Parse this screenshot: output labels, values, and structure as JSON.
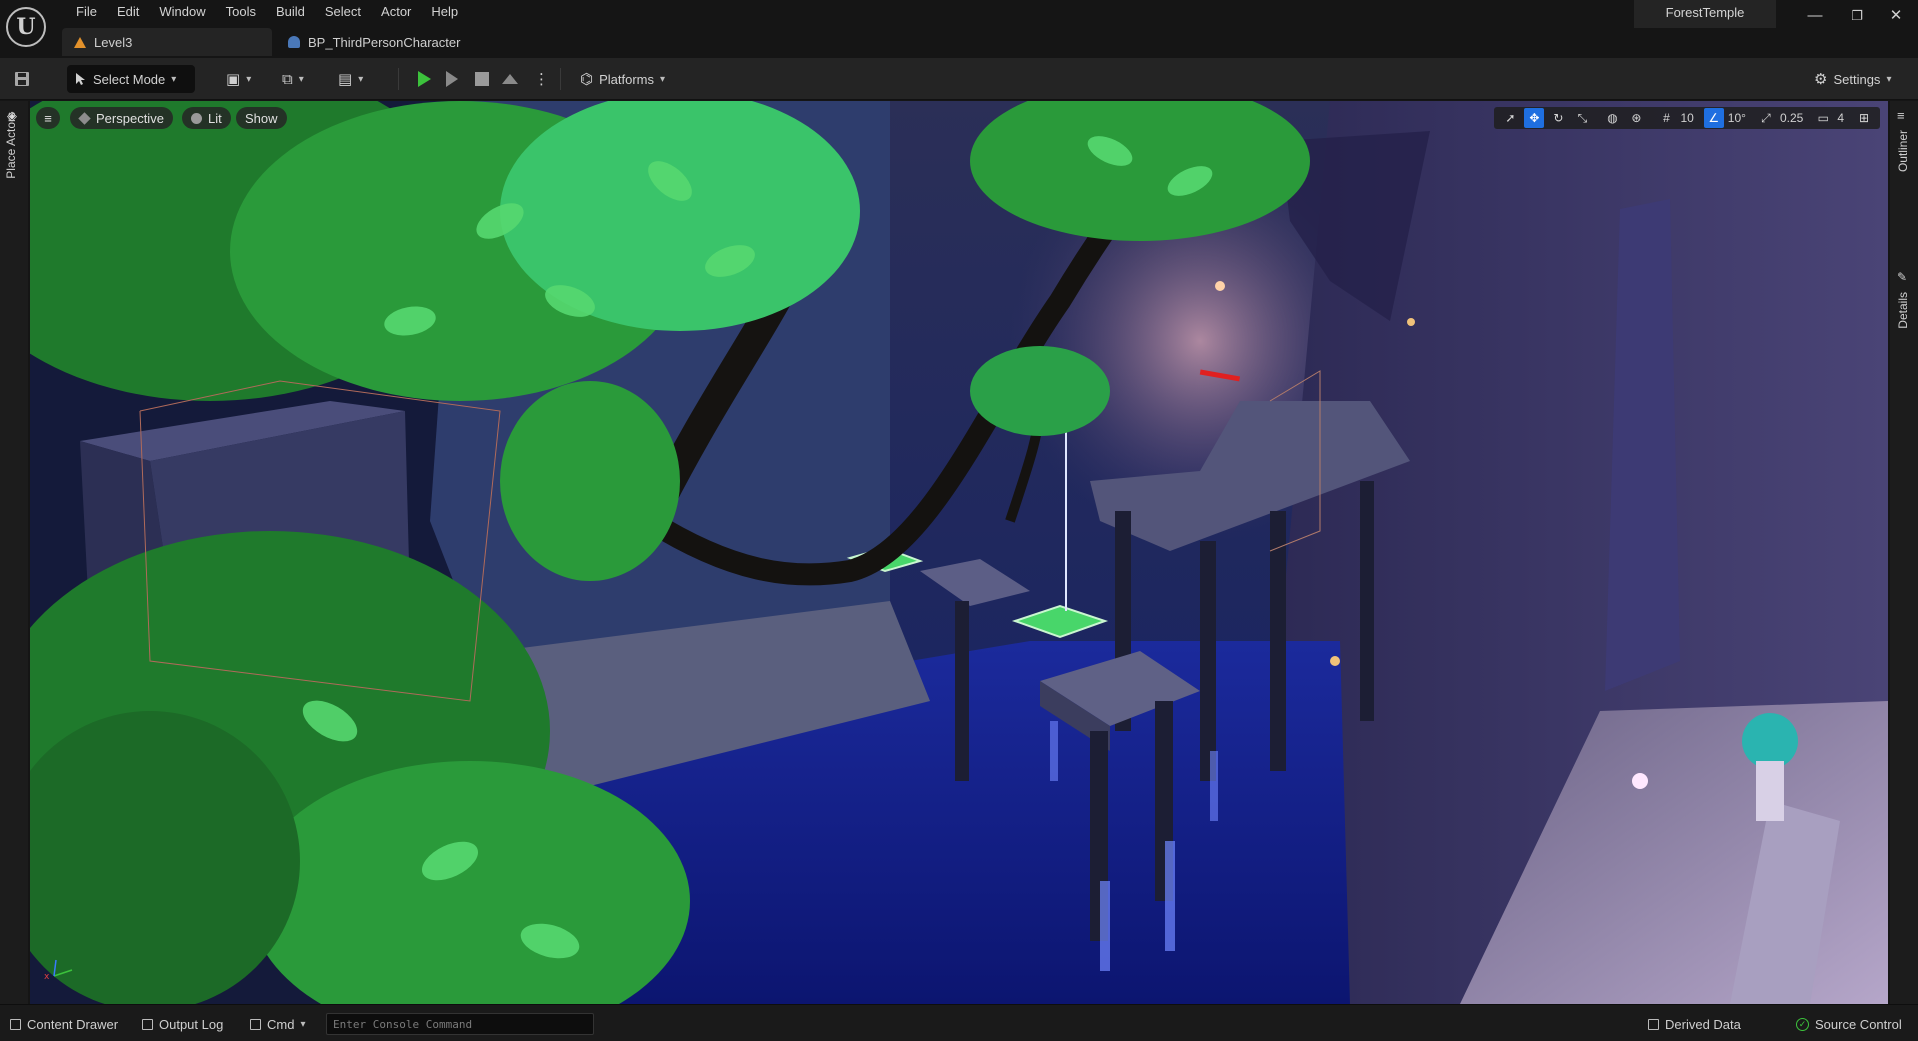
{
  "menu": [
    "File",
    "Edit",
    "Window",
    "Tools",
    "Build",
    "Select",
    "Actor",
    "Help"
  ],
  "tabs": [
    {
      "label": "Level3",
      "icon": "warning-icon"
    },
    {
      "label": "BP_ThirdPersonCharacter",
      "icon": "character-icon"
    }
  ],
  "project_name": "ForestTemple",
  "window_controls": {
    "minimize": "—",
    "restore": "❐",
    "close": "✕"
  },
  "toolbar": {
    "select_mode": "Select Mode",
    "platforms": "Platforms",
    "settings": "Settings"
  },
  "left_panel": {
    "place_actors": "Place Actors"
  },
  "right_panel": {
    "outliner": "Outliner",
    "details": "Details"
  },
  "viewport": {
    "perspective": "Perspective",
    "lit": "Lit",
    "show": "Show",
    "grid_snap": "10",
    "rotation_snap": "10°",
    "scale_snap": "0.25",
    "camera_speed": "4"
  },
  "statusbar": {
    "content_drawer": "Content Drawer",
    "output_log": "Output Log",
    "cmd": "Cmd",
    "console_placeholder": "Enter Console Command",
    "derived_data": "Derived Data",
    "source_control": "Source Control"
  },
  "colors": {
    "accent_blue": "#1f6fe0",
    "play_green": "#3cc23c",
    "warning_orange": "#e2912b",
    "water_blue": "#1f2fb8",
    "foliage_green": "#2a9a3a"
  }
}
